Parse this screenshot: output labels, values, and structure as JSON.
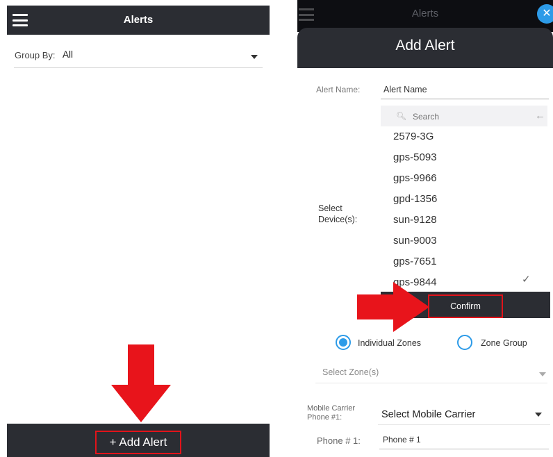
{
  "colors": {
    "header_bg": "#2b2d33",
    "accent_blue": "#2d9be8",
    "highlight_red": "#e2131a"
  },
  "left": {
    "header": {
      "title": "Alerts",
      "menu_icon": "hamburger-icon"
    },
    "group_by": {
      "label": "Group By:",
      "value": "All"
    },
    "footer": {
      "add_alert_label": "+ Add Alert"
    }
  },
  "right": {
    "background_header": {
      "title": "Alerts",
      "close_icon": "close-icon",
      "close_glyph": "✕"
    },
    "modal": {
      "title": "Add Alert",
      "alert_name": {
        "label": "Alert Name:",
        "value": "Alert Name"
      },
      "select_devices": {
        "label_line1": "Select",
        "label_line2": "Device(s):",
        "search_placeholder": "Search",
        "items": [
          "2579-3G",
          "gps-5093",
          "gps-9966",
          "gpd-1356",
          "sun-9128",
          "sun-9003",
          "gps-7651",
          "gps-9844"
        ],
        "checked_item": "gps-9844",
        "confirm_label": "Confirm"
      },
      "zone_type": {
        "options": [
          "Individual Zones",
          "Zone Group"
        ],
        "selected": "Individual Zones"
      },
      "select_zone": {
        "placeholder": "Select Zone(s)"
      },
      "mobile_carrier": {
        "label_line1": "Mobile Carrier",
        "label_line2": "Phone #1:",
        "value": "Select Mobile Carrier"
      },
      "phone1": {
        "label": "Phone # 1:",
        "placeholder": "Phone # 1"
      }
    }
  }
}
